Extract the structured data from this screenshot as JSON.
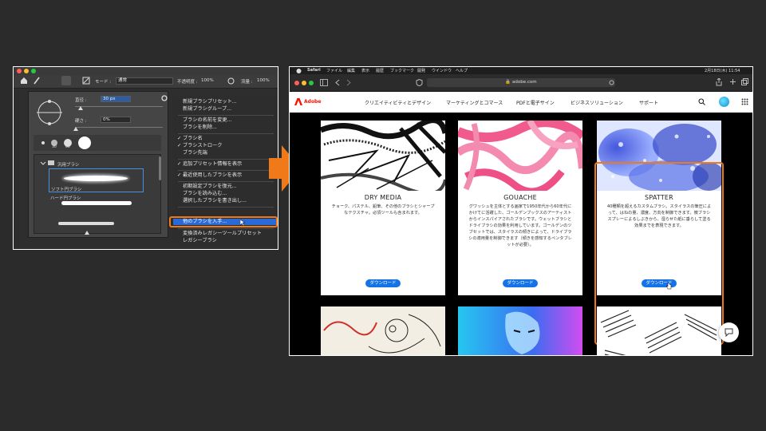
{
  "photoshop": {
    "options_bar": {
      "mode_label": "モード :",
      "mode_value": "通常",
      "opacity_label": "不透明度 :",
      "opacity_value": "100%",
      "flow_label": "流量 :",
      "flow_value": "100%"
    },
    "picker": {
      "size_label": "直径 :",
      "size_value": "30 px",
      "hardness_label": "硬さ :",
      "hardness_value": "0%",
      "preset_sizes": [
        "30",
        "60"
      ],
      "folder_label": "汎用ブラシ",
      "brush_soft_label": "ソフト円ブラシ",
      "brush_hard_label": "ハード円ブラシ"
    },
    "menu": {
      "items": [
        {
          "label": "新規ブラシプリセット...",
          "checked": false
        },
        {
          "label": "新規ブラシグループ...",
          "checked": false
        },
        {
          "label": "ブラシの名前を変更...",
          "checked": false
        },
        {
          "label": "ブラシを削除...",
          "checked": false
        },
        {
          "label": "ブラシ名",
          "checked": true
        },
        {
          "label": "ブラシストローク",
          "checked": true
        },
        {
          "label": "ブラシ先端",
          "checked": false
        },
        {
          "label": "追加プリセット情報を表示",
          "checked": true
        },
        {
          "label": "最近使用したブラシを表示",
          "checked": true
        },
        {
          "label": "初期設定ブラシを復元...",
          "checked": false
        },
        {
          "label": "ブラシを読み込む...",
          "checked": false
        },
        {
          "label": "選択したブラシを書き出し...",
          "checked": false
        },
        {
          "label": "他のブラシを入手...",
          "checked": false
        },
        {
          "label": "変換済みレガシーツールプリセット",
          "checked": false
        },
        {
          "label": "レガシーブラシ",
          "checked": false
        }
      ],
      "highlighted_label": "他のブラシを入手...",
      "highlight_color": "#2a6ad6"
    }
  },
  "arrow_color": "#f07a1a",
  "safari": {
    "menu_bar": [
      "Safari",
      "ファイル",
      "編集",
      "表示",
      "履歴",
      "ブックマーク",
      "開発",
      "ウインドウ",
      "ヘルプ"
    ],
    "clock": "2月18日(木)  11:54",
    "url": "adobe.com",
    "site_nav": {
      "logo": "Adobe",
      "items": [
        "クリエイティビティとデザイン",
        "マーケティングとコマース",
        "PDFと電子サイン",
        "ビジネスソリューション",
        "サポート"
      ]
    },
    "cards": [
      {
        "title": "DRY MEDIA",
        "description": "チョーク、パステル、鉛筆、その他のブラシとシャープなテクスチャ。必須ツールも含まれます。",
        "button": "ダウンロード"
      },
      {
        "title": "GOUACHE",
        "description": "グワッシュを主体とする画家で1950年代から60年代にかけてに活躍した、ゴールデンブックスのアーティストからインスパイアされたブラシです。ウェットブラシとドライブラシの効果を利用しています。ゴールデンのツブセットでは、スタイラスの傾きによって、ドライブラシの適用量を制御できます（傾きを感知するペンタブレットが必要）。",
        "button": "ダウンロード"
      },
      {
        "title": "SPATTER",
        "description": "40種類を超えるカスタムブラシ。スタイラスの筆圧によって、はねの量、濃度、方向を制御できます。微ブラシスプレーによるしぶきから、湿らせた紙に垂らして塗る効果までを表現できます。",
        "button": "ダウンロード"
      }
    ],
    "accent_color": "#1473e6",
    "highlight_ring_color": "#f07a1a"
  }
}
